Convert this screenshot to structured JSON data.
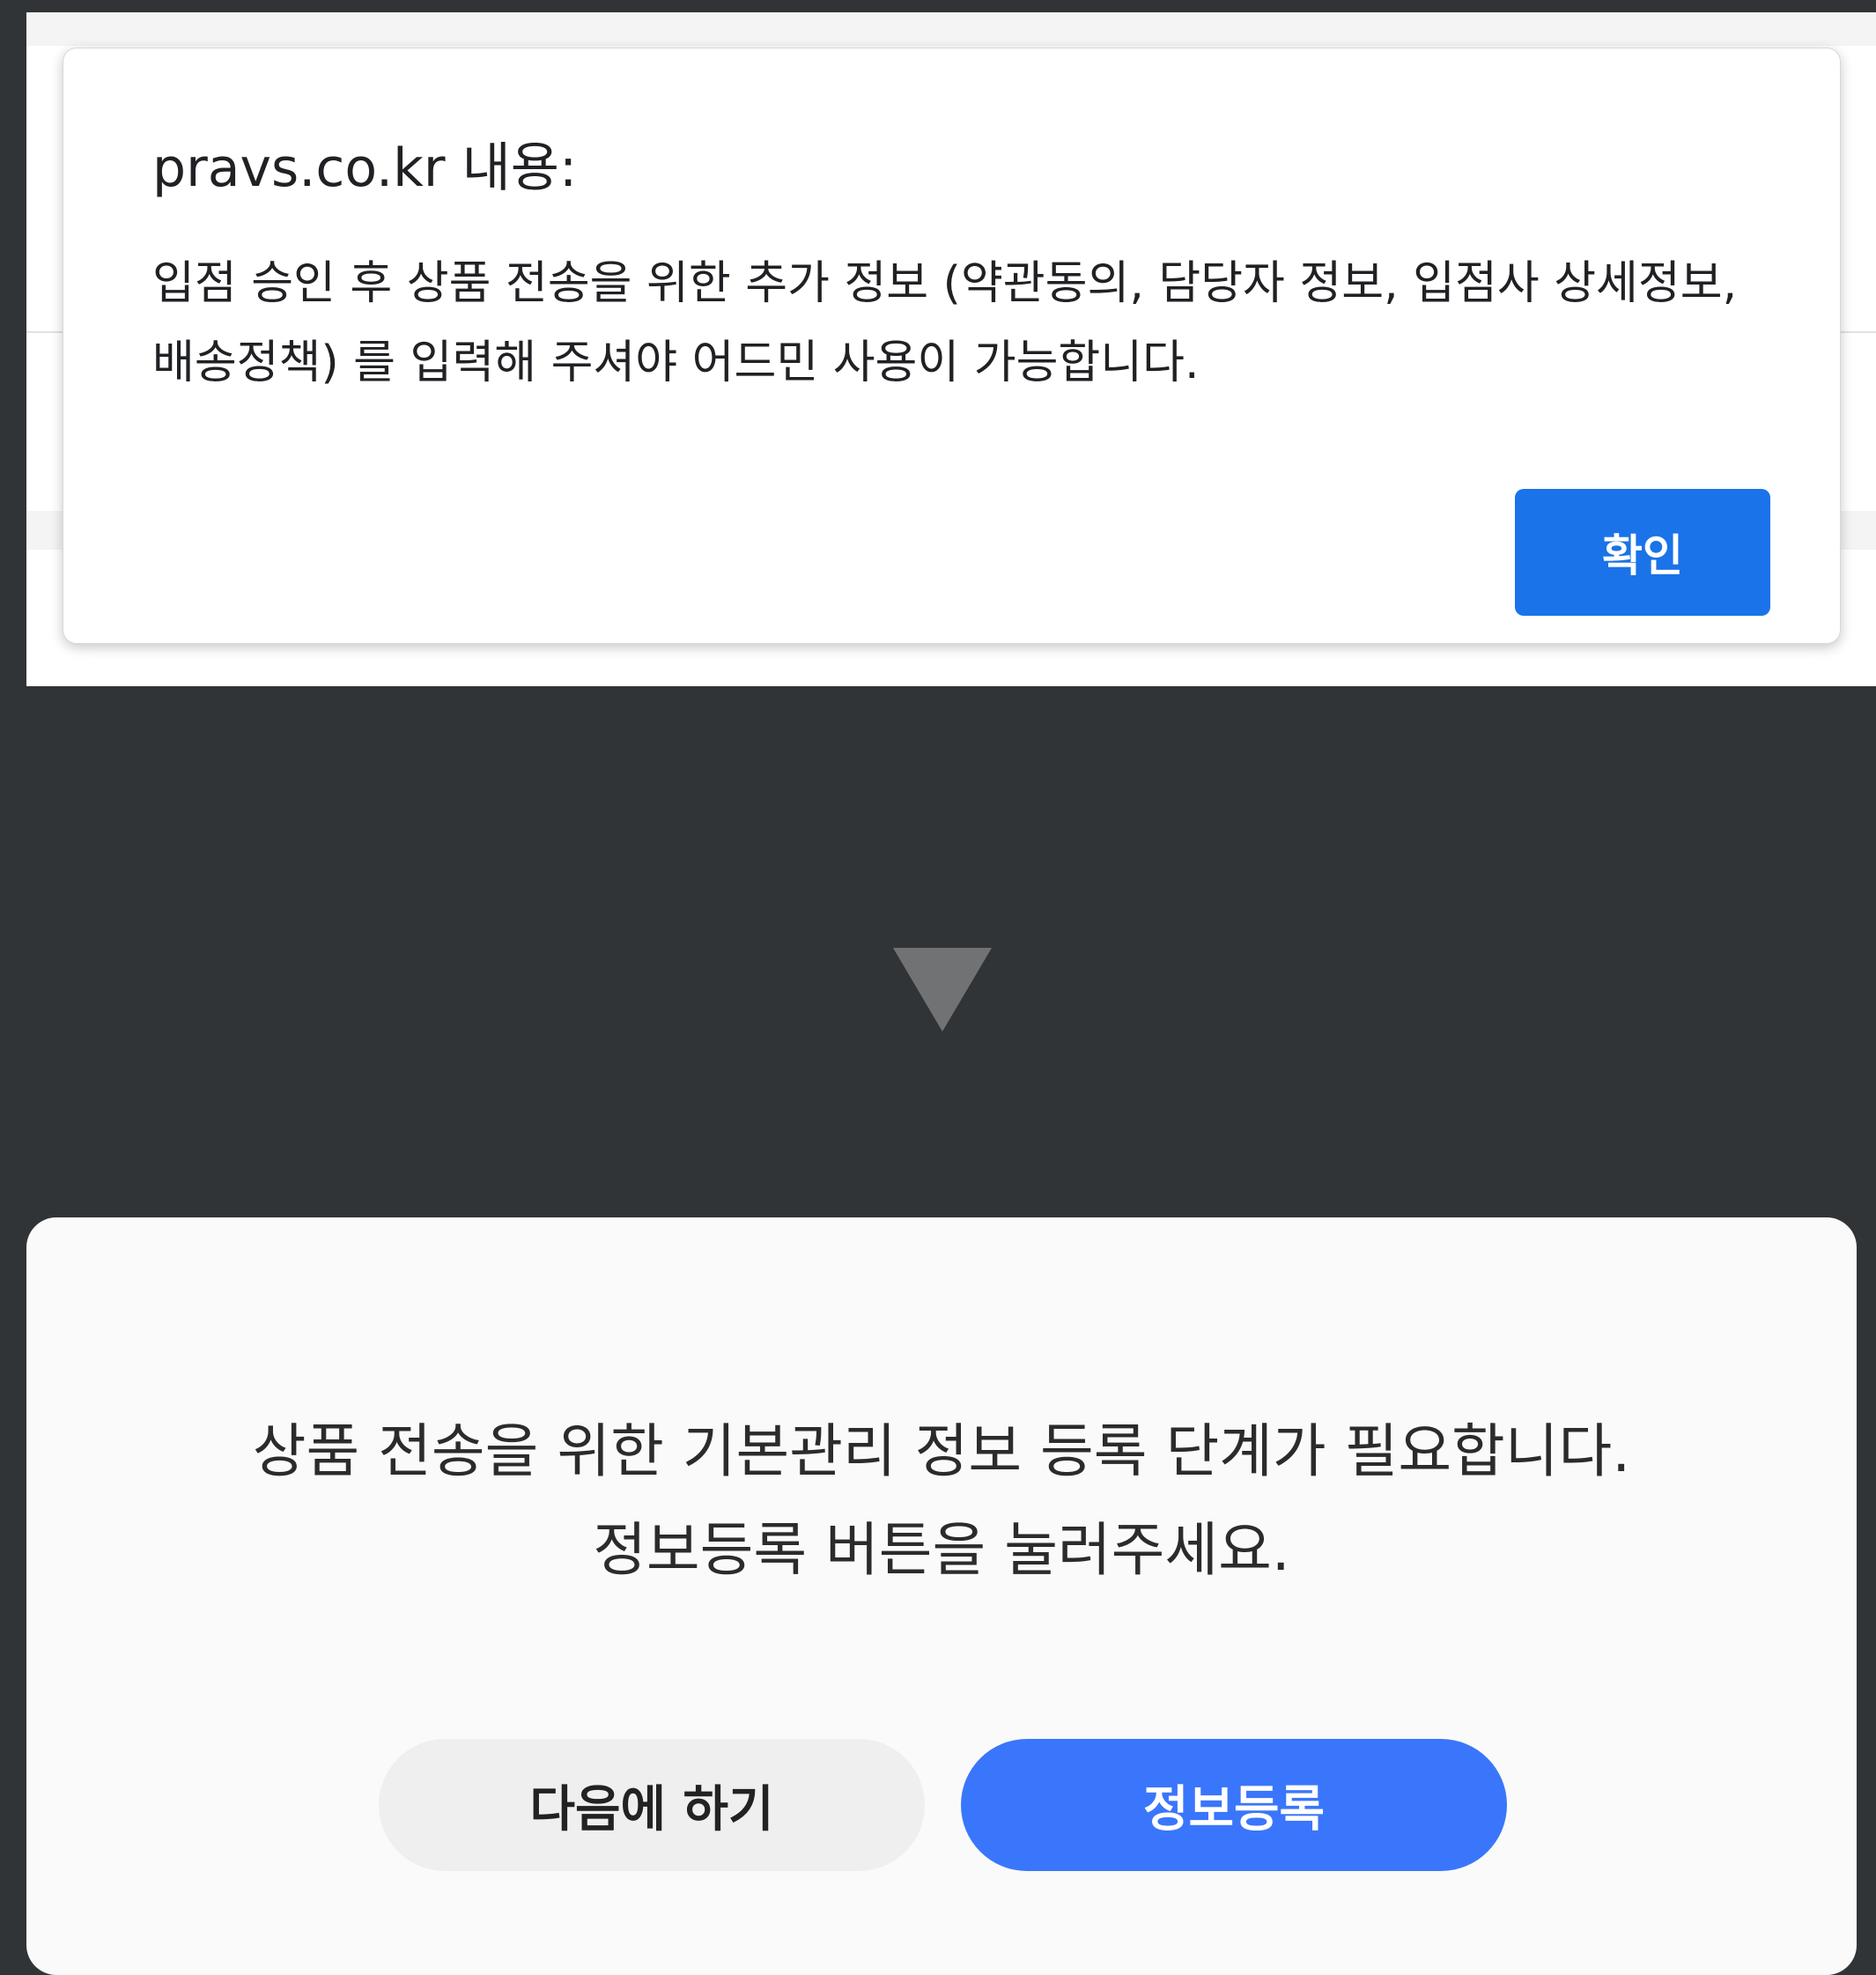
{
  "alert": {
    "title": "pravs.co.kr 내용:",
    "message": "입점 승인 후 상품 전송을 위한 추가 정보 (약관동의, 담당자 정보, 입점사 상세정보, 배송정책) 를 입력해 주셔야 어드민 사용이 가능합니다.",
    "ok_label": "확인",
    "button_color": "#1a73e8"
  },
  "arrow": {
    "icon": "down-triangle-icon"
  },
  "modal": {
    "message_line1": "상품 전송을 위한 기본관리 정보 등록 단계가 필요합니다.",
    "message_line2": "정보등록 버튼을 눌러주세요.",
    "later_label": "다음에 하기",
    "register_label": "정보등록",
    "register_color": "#3a76fb"
  },
  "colors": {
    "background": "#303437"
  }
}
